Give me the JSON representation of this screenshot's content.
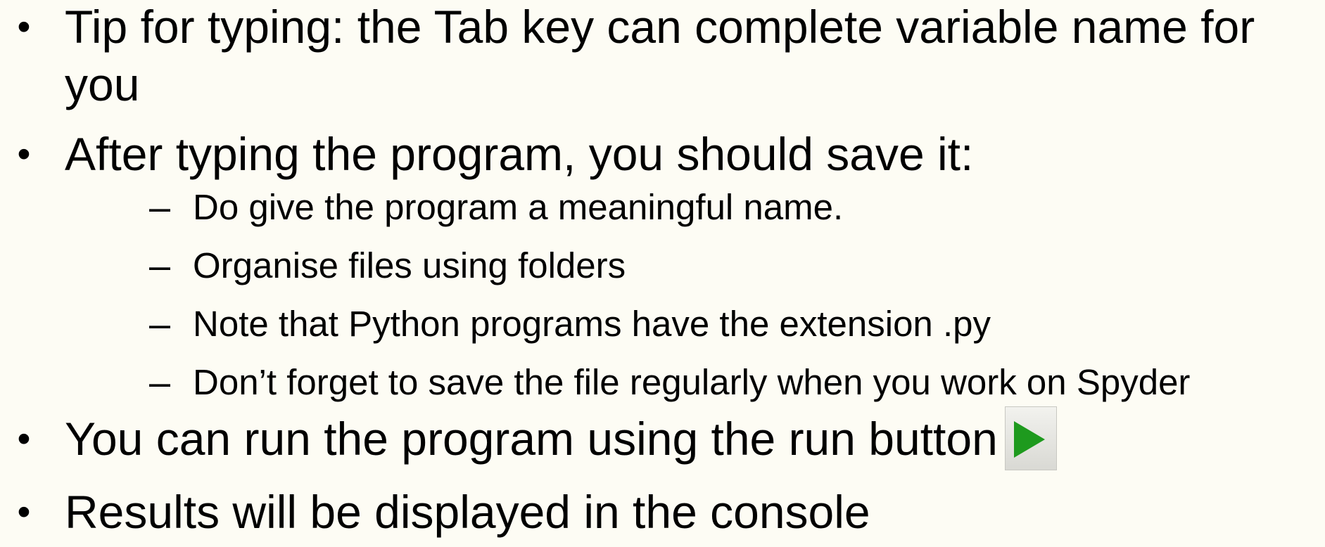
{
  "bullets": [
    {
      "marker": "•",
      "text": "Tip for typing: the Tab key can complete variable name for you"
    },
    {
      "marker": "•",
      "text": "After typing the program, you should save it:",
      "sub_items": [
        {
          "marker": "–",
          "text": "Do give the program a meaningful name."
        },
        {
          "marker": "–",
          "text": "Organise files using folders"
        },
        {
          "marker": "–",
          "text": "Note that Python programs have the extension .py"
        },
        {
          "marker": "–",
          "text": "Don’t forget to save the file regularly when you work on Spyder"
        }
      ]
    },
    {
      "marker": "•",
      "text": "You can run the program using the run button",
      "inline_icon": "run-play-icon",
      "icon_color": "#1e9a1e"
    },
    {
      "marker": "•",
      "text": "Results will be displayed in the console"
    }
  ]
}
